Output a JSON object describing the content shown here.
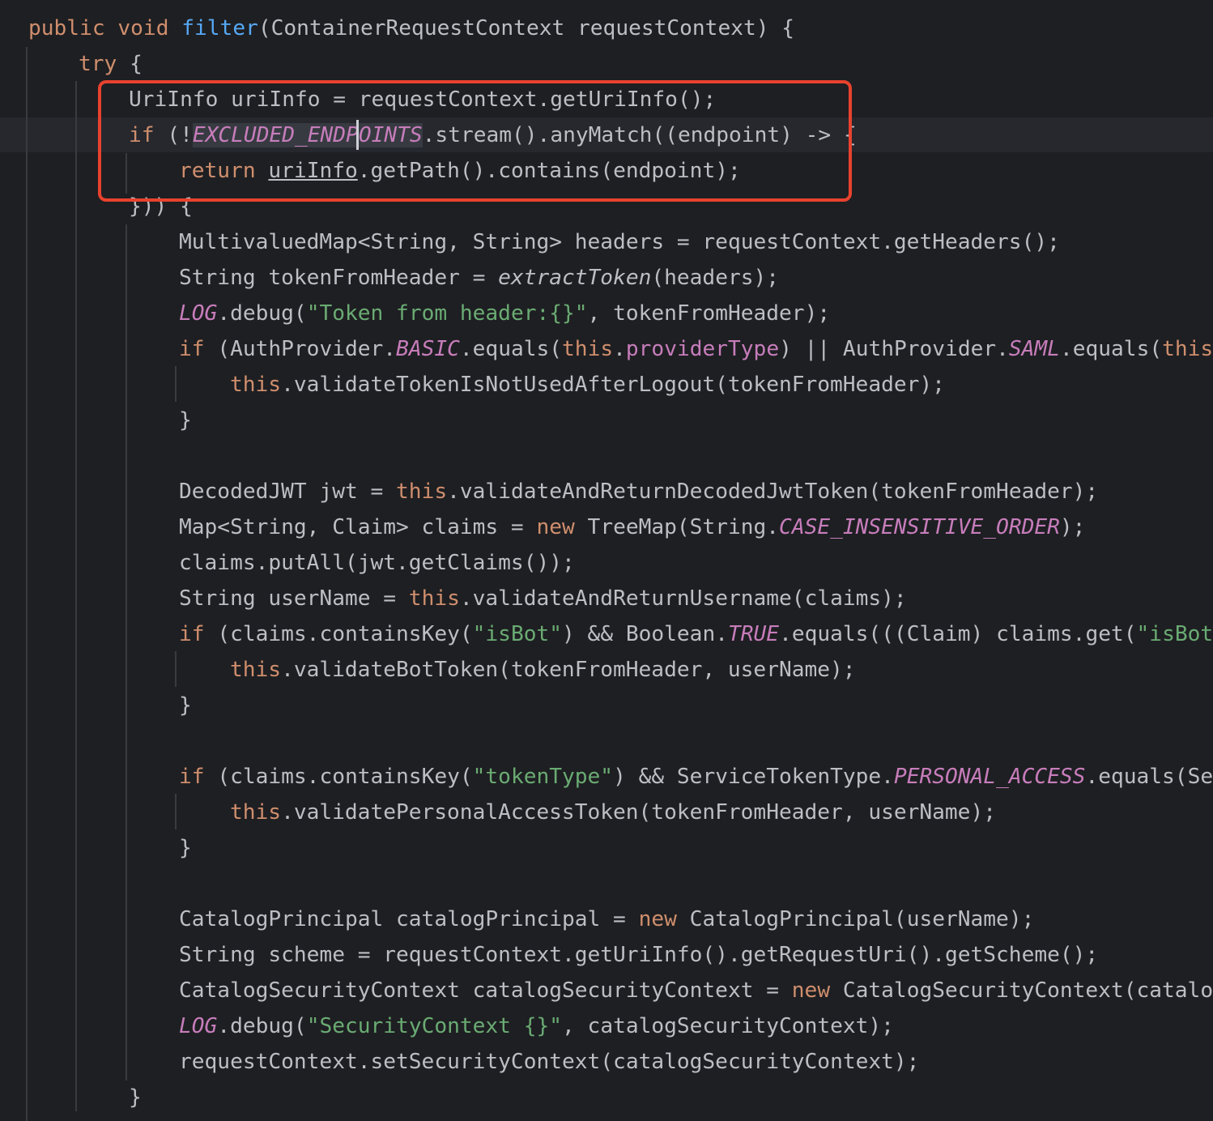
{
  "colors": {
    "background": "#1e1f22",
    "keyword": "#cf8e6d",
    "method_declaration": "#56a8f5",
    "static_field": "#c77dbb",
    "string": "#6aab73",
    "default_text": "#bcbec4",
    "annotation_box": "#e8422e"
  },
  "code": {
    "l1": {
      "a": "public",
      "b": " ",
      "c": "void",
      "d": " ",
      "e": "filter",
      "f": "(ContainerRequestContext requestContext) {"
    },
    "l2": {
      "a": "try",
      "b": " {"
    },
    "l3": {
      "a": "UriInfo uriInfo = requestContext.getUriInfo();"
    },
    "l4": {
      "a": "if",
      "b": " (!",
      "c": "EXCLUDED_ENDPOINTS",
      "d": ".stream().anyMatch((endpoint) -> {"
    },
    "l5": {
      "a": "return",
      "b": " ",
      "c": "uriInfo",
      "d": ".getPath().contains(endpoint);"
    },
    "l6": {
      "a": "})) {"
    },
    "l7": {
      "a": "MultivaluedMap<String, String> headers = requestContext.getHeaders();"
    },
    "l8": {
      "a": "String tokenFromHeader = ",
      "b": "extractToken",
      "c": "(headers);"
    },
    "l9": {
      "a": "LOG",
      "b": ".debug(",
      "c": "\"Token from header:{}\"",
      "d": ", tokenFromHeader);"
    },
    "l10": {
      "a": "if",
      "b": " (AuthProvider.",
      "c": "BASIC",
      "d": ".equals(",
      "e": "this",
      "f": ".",
      "g": "providerType",
      "h": ") || AuthProvider.",
      "i": "SAML",
      "j": ".equals(",
      "k": "this",
      "l": "."
    },
    "l11": {
      "a": "this",
      "b": ".validateTokenIsNotUsedAfterLogout(tokenFromHeader);"
    },
    "l12": {
      "a": "}"
    },
    "l13": {
      "a": "DecodedJWT jwt = ",
      "b": "this",
      "c": ".validateAndReturnDecodedJwtToken(tokenFromHeader);"
    },
    "l14": {
      "a": "Map<String, Claim> claims = ",
      "b": "new",
      "c": " TreeMap(String.",
      "d": "CASE_INSENSITIVE_ORDER",
      "e": ");"
    },
    "l15": {
      "a": "claims.putAll(jwt.getClaims());"
    },
    "l16": {
      "a": "String userName = ",
      "b": "this",
      "c": ".validateAndReturnUsername(claims);"
    },
    "l17": {
      "a": "if",
      "b": " (claims.containsKey(",
      "c": "\"isBot\"",
      "d": ") && Boolean.",
      "e": "TRUE",
      "f": ".equals(((Claim) claims.get(",
      "g": "\"isBot\""
    },
    "l18": {
      "a": "this",
      "b": ".validateBotToken(tokenFromHeader, userName);"
    },
    "l19": {
      "a": "}"
    },
    "l20": {
      "a": "if",
      "b": " (claims.containsKey(",
      "c": "\"tokenType\"",
      "d": ") && ServiceTokenType.",
      "e": "PERSONAL_ACCESS",
      "f": ".equals(Ser"
    },
    "l21": {
      "a": "this",
      "b": ".validatePersonalAccessToken(tokenFromHeader, userName);"
    },
    "l22": {
      "a": "}"
    },
    "l23": {
      "a": "CatalogPrincipal catalogPrincipal = ",
      "b": "new",
      "c": " CatalogPrincipal(userName);"
    },
    "l24": {
      "a": "String scheme = requestContext.getUriInfo().getRequestUri().getScheme();"
    },
    "l25": {
      "a": "CatalogSecurityContext catalogSecurityContext = ",
      "b": "new",
      "c": " CatalogSecurityContext(catalog"
    },
    "l26": {
      "a": "LOG",
      "b": ".debug(",
      "c": "\"SecurityContext {}\"",
      "d": ", catalogSecurityContext);"
    },
    "l27": {
      "a": "requestContext.setSecurityContext(catalogSecurityContext);"
    },
    "l28": {
      "a": "}"
    }
  }
}
